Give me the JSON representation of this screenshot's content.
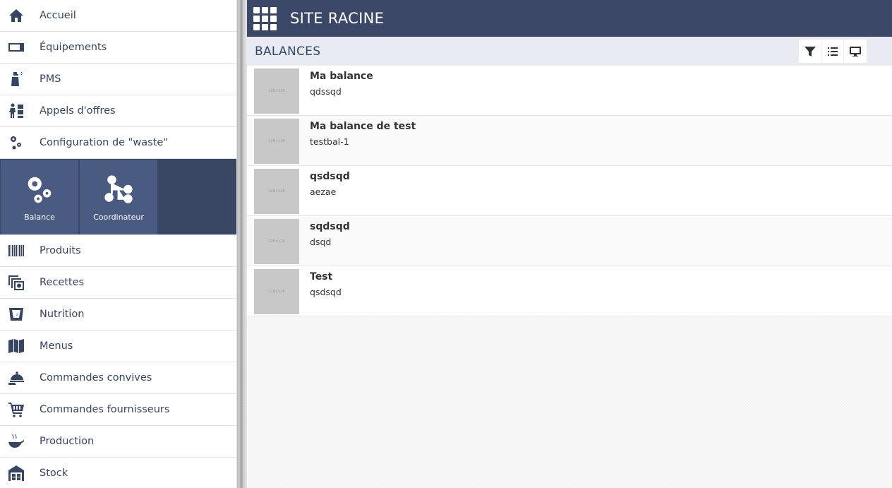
{
  "sidebar": {
    "items_top": [
      {
        "label": "Accueil",
        "icon": "home-icon"
      },
      {
        "label": "Équipements",
        "icon": "equipment-icon"
      },
      {
        "label": "PMS",
        "icon": "spray-icon"
      },
      {
        "label": "Appels d'offres",
        "icon": "tender-icon"
      },
      {
        "label": "Configuration de \"waste\"",
        "icon": "gears-icon"
      }
    ],
    "subpanel": [
      {
        "label": "Balance",
        "icon": "gears-icon"
      },
      {
        "label": "Coordinateur",
        "icon": "hierarchy-icon"
      }
    ],
    "items_bottom": [
      {
        "label": "Produits",
        "icon": "barcode-icon"
      },
      {
        "label": "Recettes",
        "icon": "recipes-icon"
      },
      {
        "label": "Nutrition",
        "icon": "nutrition-icon"
      },
      {
        "label": "Menus",
        "icon": "map-icon"
      },
      {
        "label": "Commandes convives",
        "icon": "cloche-icon"
      },
      {
        "label": "Commandes fournisseurs",
        "icon": "cart-icon"
      },
      {
        "label": "Production",
        "icon": "pan-icon"
      },
      {
        "label": "Stock",
        "icon": "warehouse-icon"
      }
    ]
  },
  "header": {
    "title": "SITE RACINE"
  },
  "section": {
    "title": "BALANCES"
  },
  "list": {
    "thumb_text": "128×128",
    "items": [
      {
        "title": "Ma balance",
        "subtitle": "qdssqd"
      },
      {
        "title": "Ma balance de test",
        "subtitle": "testbal-1"
      },
      {
        "title": "qsdsqd",
        "subtitle": "aezae"
      },
      {
        "title": "sqdsqd",
        "subtitle": "dsqd"
      },
      {
        "title": "Test",
        "subtitle": "qsdsqd"
      }
    ]
  },
  "colors": {
    "header_bg": "#3a4766",
    "tile_bg": "#4a5b82",
    "panel_bg": "#394764",
    "section_bg": "#e8ebf2"
  }
}
